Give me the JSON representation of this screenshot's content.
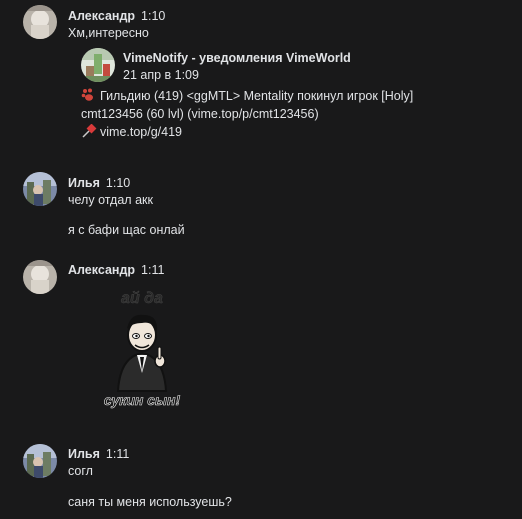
{
  "messages": [
    {
      "author": "Александр",
      "time": "1:10",
      "lines": [
        "Хм,интересно"
      ],
      "repost": {
        "author": "VimeNotify - уведомления VimeWorld",
        "date": "21 апр в 1:09",
        "lines": [
          "Гильдию (419) <ggMTL> Mentality покинул игрок [Holy]",
          "cmt123456 (60 lvl) (vime.top/p/cmt123456)",
          "vime.top/g/419"
        ],
        "icons": [
          "paw-emoji-icon",
          "pushpin-emoji-icon"
        ]
      }
    },
    {
      "author": "Илья",
      "time": "1:10",
      "lines": [
        "челу отдал акк",
        "я с бафи щас онлай"
      ]
    },
    {
      "author": "Александр",
      "time": "1:11",
      "sticker": {
        "top_text": "ай да",
        "bottom_text": "сукин сын!"
      }
    },
    {
      "author": "Илья",
      "time": "1:11",
      "lines": [
        "согл",
        "саня ты меня используешь?"
      ]
    }
  ],
  "colors": {
    "background": "#19191a",
    "text": "#e1e3e6"
  }
}
